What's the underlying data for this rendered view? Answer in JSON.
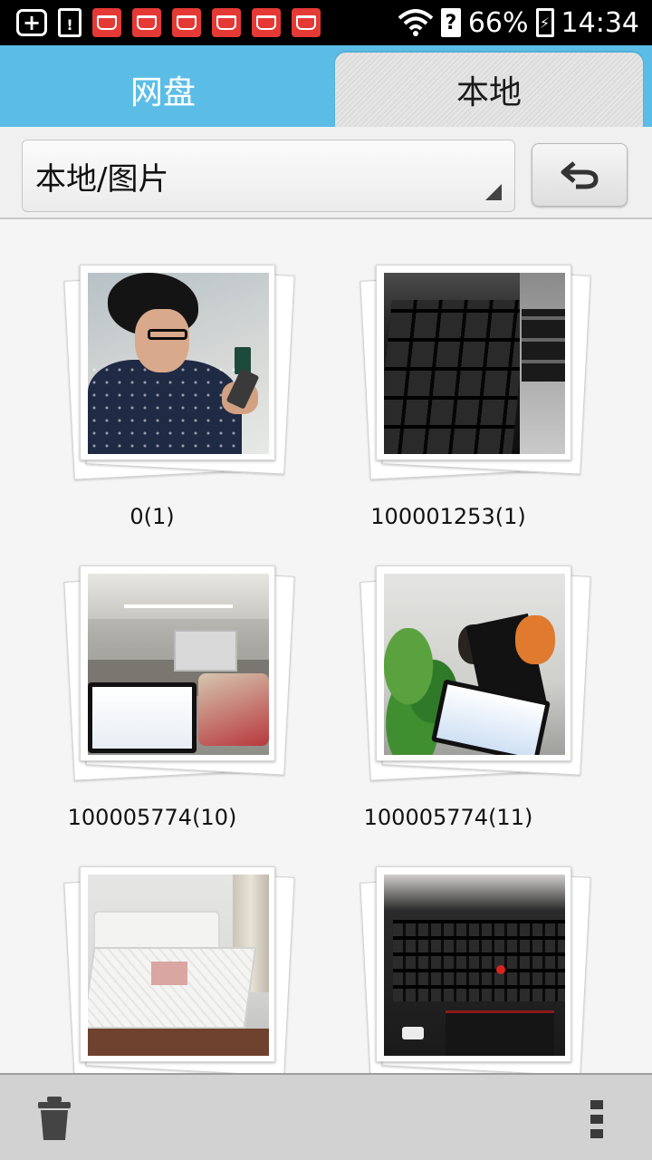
{
  "status_bar": {
    "battery_percent": "66%",
    "time": "14:34",
    "icons": [
      "add-icon",
      "battery-warning-icon",
      "app-notification-icon",
      "wifi-icon",
      "unknown-sim-icon",
      "battery-charging-icon"
    ]
  },
  "tabs": [
    {
      "label": "网盘",
      "active": false
    },
    {
      "label": "本地",
      "active": true
    }
  ],
  "path_bar": {
    "current_path": "本地/图片",
    "back_icon": "back-arrow-icon"
  },
  "photos": [
    {
      "name": "0(1)"
    },
    {
      "name": "100001253(1)"
    },
    {
      "name": "100005774(10)"
    },
    {
      "name": "100005774(11)"
    },
    {
      "name": ""
    },
    {
      "name": ""
    }
  ],
  "bottom_bar": {
    "delete_icon": "trash-icon",
    "menu_icon": "more-vertical-icon"
  },
  "colors": {
    "tab_bar": "#5bbde6",
    "background": "#f5f5f5",
    "bottom_bar": "#d2d2d2"
  }
}
